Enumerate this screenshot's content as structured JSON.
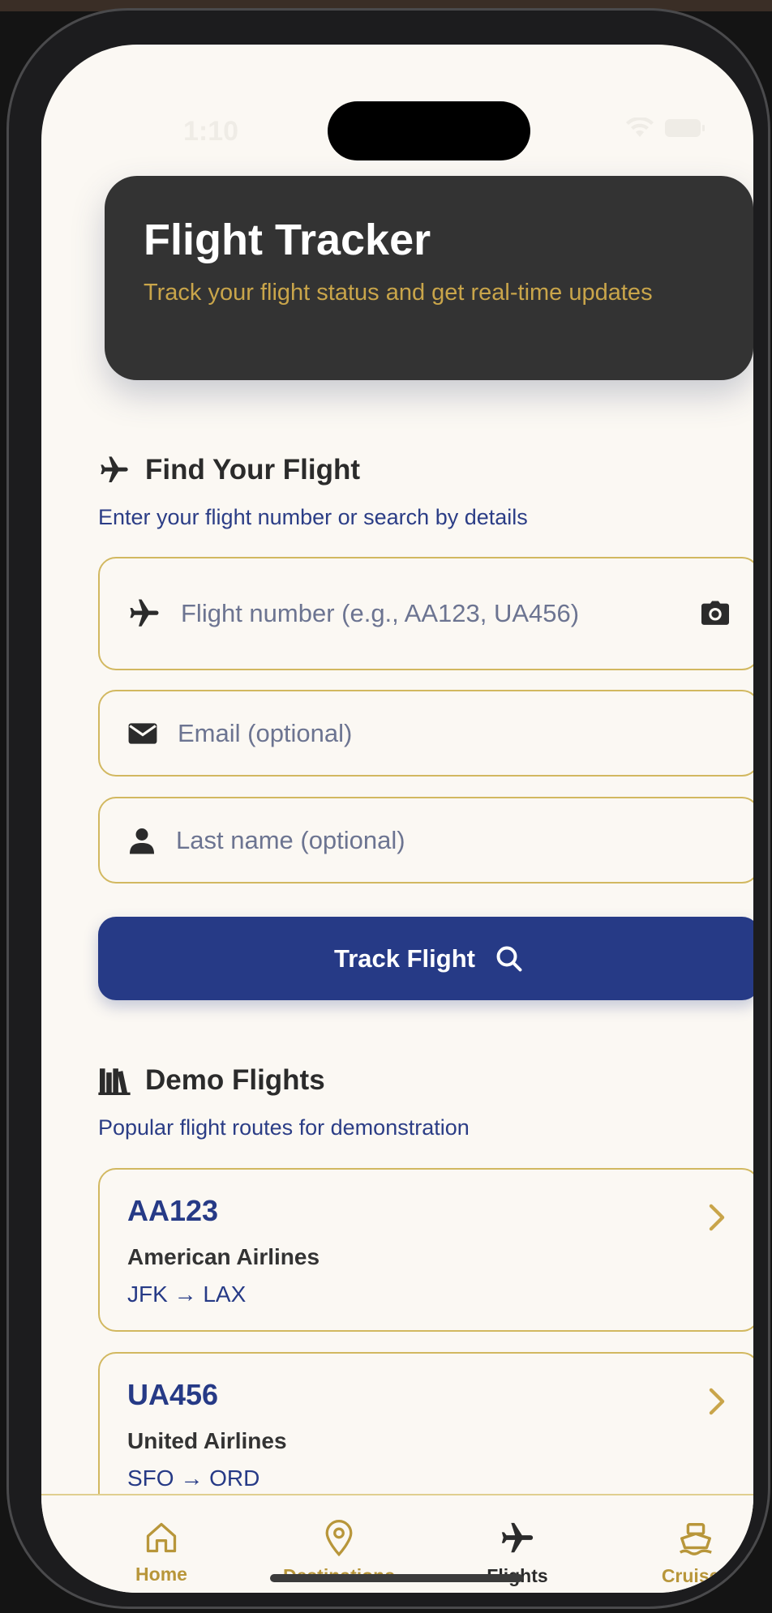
{
  "status_bar": {
    "time": "1:10"
  },
  "header": {
    "title": "Flight Tracker",
    "subtitle": "Track your flight status and get real-time updates"
  },
  "find_section": {
    "title": "Find Your Flight",
    "subtitle": "Enter your flight number or search by details",
    "flight_number_placeholder": "Flight number (e.g., AA123, UA456)",
    "email_placeholder": "Email (optional)",
    "lastname_placeholder": "Last name (optional)",
    "track_button": "Track Flight"
  },
  "demo_section": {
    "title": "Demo Flights",
    "subtitle": "Popular flight routes for demonstration",
    "flights": [
      {
        "code": "AA123",
        "airline": "American Airlines",
        "route": "JFK → LAX"
      },
      {
        "code": "UA456",
        "airline": "United Airlines",
        "route": "SFO → ORD"
      }
    ]
  },
  "tabbar": {
    "tabs": [
      {
        "label": "Home",
        "icon": "home-icon"
      },
      {
        "label": "Destinations",
        "icon": "map-pin-icon"
      },
      {
        "label": "Flights",
        "icon": "airplane-icon",
        "active": true
      },
      {
        "label": "Cruises",
        "icon": "ship-icon"
      }
    ]
  },
  "colors": {
    "accent_navy": "#263a86",
    "accent_gold": "#c9a54a",
    "background": "#fbf8f3",
    "header_bg": "#333333"
  }
}
